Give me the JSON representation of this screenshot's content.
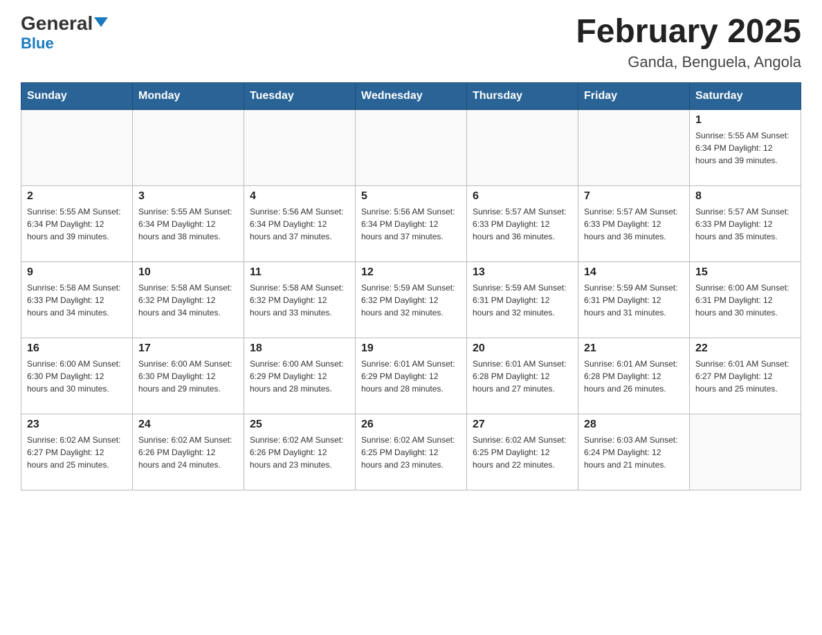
{
  "header": {
    "logo_general": "General",
    "logo_blue": "Blue",
    "title": "February 2025",
    "subtitle": "Ganda, Benguela, Angola"
  },
  "days_of_week": [
    "Sunday",
    "Monday",
    "Tuesday",
    "Wednesday",
    "Thursday",
    "Friday",
    "Saturday"
  ],
  "weeks": [
    [
      {
        "day": "",
        "info": ""
      },
      {
        "day": "",
        "info": ""
      },
      {
        "day": "",
        "info": ""
      },
      {
        "day": "",
        "info": ""
      },
      {
        "day": "",
        "info": ""
      },
      {
        "day": "",
        "info": ""
      },
      {
        "day": "1",
        "info": "Sunrise: 5:55 AM\nSunset: 6:34 PM\nDaylight: 12 hours\nand 39 minutes."
      }
    ],
    [
      {
        "day": "2",
        "info": "Sunrise: 5:55 AM\nSunset: 6:34 PM\nDaylight: 12 hours\nand 39 minutes."
      },
      {
        "day": "3",
        "info": "Sunrise: 5:55 AM\nSunset: 6:34 PM\nDaylight: 12 hours\nand 38 minutes."
      },
      {
        "day": "4",
        "info": "Sunrise: 5:56 AM\nSunset: 6:34 PM\nDaylight: 12 hours\nand 37 minutes."
      },
      {
        "day": "5",
        "info": "Sunrise: 5:56 AM\nSunset: 6:34 PM\nDaylight: 12 hours\nand 37 minutes."
      },
      {
        "day": "6",
        "info": "Sunrise: 5:57 AM\nSunset: 6:33 PM\nDaylight: 12 hours\nand 36 minutes."
      },
      {
        "day": "7",
        "info": "Sunrise: 5:57 AM\nSunset: 6:33 PM\nDaylight: 12 hours\nand 36 minutes."
      },
      {
        "day": "8",
        "info": "Sunrise: 5:57 AM\nSunset: 6:33 PM\nDaylight: 12 hours\nand 35 minutes."
      }
    ],
    [
      {
        "day": "9",
        "info": "Sunrise: 5:58 AM\nSunset: 6:33 PM\nDaylight: 12 hours\nand 34 minutes."
      },
      {
        "day": "10",
        "info": "Sunrise: 5:58 AM\nSunset: 6:32 PM\nDaylight: 12 hours\nand 34 minutes."
      },
      {
        "day": "11",
        "info": "Sunrise: 5:58 AM\nSunset: 6:32 PM\nDaylight: 12 hours\nand 33 minutes."
      },
      {
        "day": "12",
        "info": "Sunrise: 5:59 AM\nSunset: 6:32 PM\nDaylight: 12 hours\nand 32 minutes."
      },
      {
        "day": "13",
        "info": "Sunrise: 5:59 AM\nSunset: 6:31 PM\nDaylight: 12 hours\nand 32 minutes."
      },
      {
        "day": "14",
        "info": "Sunrise: 5:59 AM\nSunset: 6:31 PM\nDaylight: 12 hours\nand 31 minutes."
      },
      {
        "day": "15",
        "info": "Sunrise: 6:00 AM\nSunset: 6:31 PM\nDaylight: 12 hours\nand 30 minutes."
      }
    ],
    [
      {
        "day": "16",
        "info": "Sunrise: 6:00 AM\nSunset: 6:30 PM\nDaylight: 12 hours\nand 30 minutes."
      },
      {
        "day": "17",
        "info": "Sunrise: 6:00 AM\nSunset: 6:30 PM\nDaylight: 12 hours\nand 29 minutes."
      },
      {
        "day": "18",
        "info": "Sunrise: 6:00 AM\nSunset: 6:29 PM\nDaylight: 12 hours\nand 28 minutes."
      },
      {
        "day": "19",
        "info": "Sunrise: 6:01 AM\nSunset: 6:29 PM\nDaylight: 12 hours\nand 28 minutes."
      },
      {
        "day": "20",
        "info": "Sunrise: 6:01 AM\nSunset: 6:28 PM\nDaylight: 12 hours\nand 27 minutes."
      },
      {
        "day": "21",
        "info": "Sunrise: 6:01 AM\nSunset: 6:28 PM\nDaylight: 12 hours\nand 26 minutes."
      },
      {
        "day": "22",
        "info": "Sunrise: 6:01 AM\nSunset: 6:27 PM\nDaylight: 12 hours\nand 25 minutes."
      }
    ],
    [
      {
        "day": "23",
        "info": "Sunrise: 6:02 AM\nSunset: 6:27 PM\nDaylight: 12 hours\nand 25 minutes."
      },
      {
        "day": "24",
        "info": "Sunrise: 6:02 AM\nSunset: 6:26 PM\nDaylight: 12 hours\nand 24 minutes."
      },
      {
        "day": "25",
        "info": "Sunrise: 6:02 AM\nSunset: 6:26 PM\nDaylight: 12 hours\nand 23 minutes."
      },
      {
        "day": "26",
        "info": "Sunrise: 6:02 AM\nSunset: 6:25 PM\nDaylight: 12 hours\nand 23 minutes."
      },
      {
        "day": "27",
        "info": "Sunrise: 6:02 AM\nSunset: 6:25 PM\nDaylight: 12 hours\nand 22 minutes."
      },
      {
        "day": "28",
        "info": "Sunrise: 6:03 AM\nSunset: 6:24 PM\nDaylight: 12 hours\nand 21 minutes."
      },
      {
        "day": "",
        "info": ""
      }
    ]
  ]
}
